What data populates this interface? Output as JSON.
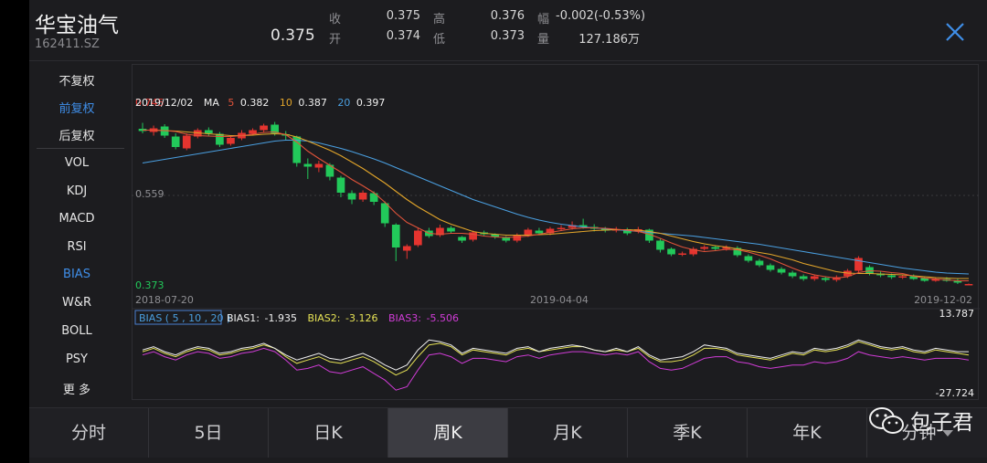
{
  "stock": {
    "name": "华宝油气",
    "code": "162411.SZ",
    "price": "0.375"
  },
  "quote": [
    {
      "label": "收",
      "value": "0.375"
    },
    {
      "label": "高",
      "value": "0.376"
    },
    {
      "label": "幅",
      "value": "-0.002(-0.53%)"
    },
    {
      "label": "开",
      "value": "0.374"
    },
    {
      "label": "低",
      "value": "0.373"
    },
    {
      "label": "量",
      "value": "127.186万"
    }
  ],
  "sidebar": {
    "adjust": [
      {
        "label": "不复权",
        "active": false
      },
      {
        "label": "前复权",
        "active": true
      },
      {
        "label": "后复权",
        "active": false
      }
    ],
    "indicators": [
      {
        "label": "VOL",
        "active": false
      },
      {
        "label": "KDJ",
        "active": false
      },
      {
        "label": "MACD",
        "active": false
      },
      {
        "label": "RSI",
        "active": false
      },
      {
        "label": "BIAS",
        "active": true
      },
      {
        "label": "W&R",
        "active": false
      },
      {
        "label": "BOLL",
        "active": false
      },
      {
        "label": "PSY",
        "active": false
      },
      {
        "label": "更 多",
        "active": false
      }
    ]
  },
  "chart_data": {
    "type": "candlestick",
    "ma_legend": {
      "date": "2019/12/02",
      "label": "MA",
      "items": [
        {
          "period": "5",
          "value": "0.382",
          "color": "#e0533a"
        },
        {
          "period": "10",
          "value": "0.387",
          "color": "#e2a52a"
        },
        {
          "period": "20",
          "value": "0.397",
          "color": "#4a9fe0"
        }
      ]
    },
    "y_labels": {
      "top": "0.745",
      "mid": "0.559",
      "bottom": "0.373"
    },
    "ylim": [
      0.373,
      0.745
    ],
    "x_labels": [
      "2018-07-20",
      "2019-04-04",
      "2019-12-02"
    ],
    "colors": {
      "up": "#e5342f",
      "down": "#22c95a",
      "ma5": "#e0533a",
      "ma10": "#e2a52a",
      "ma20": "#4a9fe0"
    },
    "candles": [
      [
        0.715,
        0.71,
        0.728,
        0.705
      ],
      [
        0.708,
        0.716,
        0.722,
        0.7
      ],
      [
        0.72,
        0.7,
        0.725,
        0.695
      ],
      [
        0.698,
        0.675,
        0.705,
        0.67
      ],
      [
        0.672,
        0.7,
        0.705,
        0.668
      ],
      [
        0.698,
        0.712,
        0.716,
        0.694
      ],
      [
        0.712,
        0.705,
        0.718,
        0.7
      ],
      [
        0.704,
        0.68,
        0.708,
        0.675
      ],
      [
        0.682,
        0.695,
        0.7,
        0.678
      ],
      [
        0.694,
        0.706,
        0.712,
        0.69
      ],
      [
        0.704,
        0.712,
        0.716,
        0.7
      ],
      [
        0.712,
        0.722,
        0.726,
        0.708
      ],
      [
        0.724,
        0.705,
        0.73,
        0.7
      ],
      [
        0.703,
        0.7,
        0.71,
        0.69
      ],
      [
        0.698,
        0.64,
        0.7,
        0.632
      ],
      [
        0.638,
        0.632,
        0.65,
        0.605
      ],
      [
        0.63,
        0.638,
        0.645,
        0.62
      ],
      [
        0.636,
        0.61,
        0.64,
        0.602
      ],
      [
        0.608,
        0.575,
        0.612,
        0.565
      ],
      [
        0.574,
        0.56,
        0.58,
        0.55
      ],
      [
        0.56,
        0.575,
        0.58,
        0.555
      ],
      [
        0.574,
        0.555,
        0.578,
        0.548
      ],
      [
        0.552,
        0.508,
        0.556,
        0.5
      ],
      [
        0.505,
        0.455,
        0.508,
        0.425
      ],
      [
        0.448,
        0.458,
        0.462,
        0.43
      ],
      [
        0.46,
        0.492,
        0.498,
        0.456
      ],
      [
        0.492,
        0.48,
        0.498,
        0.476
      ],
      [
        0.482,
        0.498,
        0.505,
        0.478
      ],
      [
        0.498,
        0.49,
        0.502,
        0.486
      ],
      [
        0.478,
        0.47,
        0.48,
        0.465
      ],
      [
        0.472,
        0.488,
        0.492,
        0.468
      ],
      [
        0.488,
        0.484,
        0.492,
        0.48
      ],
      [
        0.484,
        0.478,
        0.486,
        0.474
      ],
      [
        0.478,
        0.47,
        0.48,
        0.466
      ],
      [
        0.47,
        0.482,
        0.486,
        0.466
      ],
      [
        0.482,
        0.494,
        0.498,
        0.478
      ],
      [
        0.492,
        0.486,
        0.498,
        0.482
      ],
      [
        0.486,
        0.496,
        0.5,
        0.482
      ],
      [
        0.496,
        0.498,
        0.504,
        0.492
      ],
      [
        0.498,
        0.504,
        0.512,
        0.494
      ],
      [
        0.504,
        0.5,
        0.518,
        0.496
      ],
      [
        0.5,
        0.496,
        0.506,
        0.49
      ],
      [
        0.496,
        0.492,
        0.5,
        0.488
      ],
      [
        0.492,
        0.495,
        0.5,
        0.488
      ],
      [
        0.495,
        0.486,
        0.498,
        0.482
      ],
      [
        0.49,
        0.495,
        0.5,
        0.486
      ],
      [
        0.494,
        0.47,
        0.496,
        0.465
      ],
      [
        0.47,
        0.45,
        0.474,
        0.444
      ],
      [
        0.452,
        0.44,
        0.455,
        0.436
      ],
      [
        0.44,
        0.442,
        0.446,
        0.436
      ],
      [
        0.44,
        0.452,
        0.456,
        0.436
      ],
      [
        0.452,
        0.456,
        0.46,
        0.448
      ],
      [
        0.456,
        0.452,
        0.46,
        0.448
      ],
      [
        0.452,
        0.456,
        0.46,
        0.448
      ],
      [
        0.454,
        0.438,
        0.458,
        0.434
      ],
      [
        0.436,
        0.426,
        0.44,
        0.422
      ],
      [
        0.426,
        0.416,
        0.43,
        0.412
      ],
      [
        0.416,
        0.406,
        0.42,
        0.402
      ],
      [
        0.408,
        0.4,
        0.412,
        0.396
      ],
      [
        0.4,
        0.392,
        0.404,
        0.388
      ],
      [
        0.392,
        0.386,
        0.396,
        0.382
      ],
      [
        0.386,
        0.392,
        0.396,
        0.382
      ],
      [
        0.388,
        0.384,
        0.392,
        0.38
      ],
      [
        0.384,
        0.39,
        0.394,
        0.38
      ],
      [
        0.392,
        0.404,
        0.408,
        0.388
      ],
      [
        0.404,
        0.432,
        0.436,
        0.4
      ],
      [
        0.412,
        0.398,
        0.416,
        0.394
      ],
      [
        0.398,
        0.394,
        0.402,
        0.39
      ],
      [
        0.394,
        0.39,
        0.398,
        0.386
      ],
      [
        0.39,
        0.392,
        0.396,
        0.386
      ],
      [
        0.392,
        0.386,
        0.396,
        0.384
      ],
      [
        0.388,
        0.382,
        0.392,
        0.38
      ],
      [
        0.382,
        0.386,
        0.39,
        0.38
      ],
      [
        0.386,
        0.382,
        0.39,
        0.38
      ],
      [
        0.382,
        0.378,
        0.386,
        0.375
      ],
      [
        0.374,
        0.375,
        0.376,
        0.373
      ]
    ],
    "ma5": [
      0.712,
      0.712,
      0.711,
      0.709,
      0.703,
      0.7,
      0.699,
      0.698,
      0.698,
      0.7,
      0.703,
      0.707,
      0.708,
      0.702,
      0.686,
      0.666,
      0.65,
      0.635,
      0.62,
      0.604,
      0.59,
      0.575,
      0.554,
      0.53,
      0.51,
      0.498,
      0.486,
      0.484,
      0.486,
      0.486,
      0.484,
      0.48,
      0.478,
      0.477,
      0.478,
      0.48,
      0.484,
      0.488,
      0.492,
      0.496,
      0.498,
      0.498,
      0.497,
      0.495,
      0.493,
      0.49,
      0.484,
      0.475,
      0.465,
      0.456,
      0.45,
      0.446,
      0.448,
      0.451,
      0.45,
      0.445,
      0.438,
      0.43,
      0.42,
      0.41,
      0.401,
      0.395,
      0.391,
      0.388,
      0.391,
      0.4,
      0.404,
      0.403,
      0.4,
      0.398,
      0.392,
      0.388,
      0.386,
      0.384,
      0.382,
      0.382
    ],
    "ma10": [
      0.712,
      0.712,
      0.711,
      0.71,
      0.708,
      0.706,
      0.704,
      0.702,
      0.7,
      0.7,
      0.701,
      0.703,
      0.704,
      0.703,
      0.697,
      0.688,
      0.678,
      0.668,
      0.656,
      0.642,
      0.628,
      0.612,
      0.596,
      0.578,
      0.56,
      0.544,
      0.53,
      0.516,
      0.506,
      0.498,
      0.49,
      0.486,
      0.484,
      0.482,
      0.482,
      0.482,
      0.483,
      0.484,
      0.486,
      0.488,
      0.49,
      0.492,
      0.493,
      0.494,
      0.494,
      0.493,
      0.49,
      0.486,
      0.48,
      0.474,
      0.468,
      0.463,
      0.459,
      0.456,
      0.452,
      0.448,
      0.444,
      0.44,
      0.434,
      0.428,
      0.42,
      0.414,
      0.408,
      0.402,
      0.399,
      0.398,
      0.398,
      0.397,
      0.396,
      0.395,
      0.393,
      0.391,
      0.389,
      0.388,
      0.387,
      0.387
    ],
    "ma20": [
      0.64,
      0.644,
      0.648,
      0.652,
      0.656,
      0.66,
      0.664,
      0.668,
      0.672,
      0.676,
      0.68,
      0.684,
      0.688,
      0.69,
      0.69,
      0.688,
      0.684,
      0.678,
      0.672,
      0.665,
      0.657,
      0.649,
      0.64,
      0.63,
      0.62,
      0.61,
      0.6,
      0.59,
      0.58,
      0.57,
      0.56,
      0.552,
      0.544,
      0.536,
      0.528,
      0.521,
      0.515,
      0.51,
      0.506,
      0.503,
      0.5,
      0.498,
      0.496,
      0.494,
      0.492,
      0.49,
      0.488,
      0.486,
      0.484,
      0.482,
      0.48,
      0.477,
      0.474,
      0.471,
      0.468,
      0.465,
      0.462,
      0.458,
      0.454,
      0.45,
      0.446,
      0.442,
      0.438,
      0.434,
      0.43,
      0.426,
      0.422,
      0.418,
      0.414,
      0.41,
      0.407,
      0.404,
      0.401,
      0.399,
      0.398,
      0.397
    ],
    "bias": {
      "legend": "BIAS ( 5 , 10 , 20 )",
      "items": [
        {
          "label": "BIAS1:",
          "value": "-1.935",
          "color": "#f0f0f0"
        },
        {
          "label": "BIAS2:",
          "value": "-3.126",
          "color": "#e6e255"
        },
        {
          "label": "BIAS3:",
          "value": "-5.506",
          "color": "#d03cd6"
        }
      ],
      "max_label": "13.787",
      "min_label": "-27.724",
      "ylim": [
        -27.724,
        13.787
      ],
      "colors": {
        "b1": "#f0f0f0",
        "b2": "#e6e255",
        "b3": "#d03cd6"
      },
      "b1": [
        0,
        2,
        -1,
        -3,
        0,
        2,
        1,
        -2,
        -1,
        1,
        2,
        4,
        1,
        -3,
        -6,
        -4,
        -2,
        -5,
        -6,
        -4,
        -2,
        -5,
        -9,
        -12,
        -9,
        0,
        6,
        5,
        3,
        -2,
        1,
        0,
        -1,
        -2,
        1,
        2,
        -1,
        1,
        2,
        3,
        2,
        0,
        -1,
        1,
        -1,
        2,
        -3,
        -6,
        -5,
        -4,
        -1,
        3,
        2,
        1,
        -2,
        -3,
        -4,
        -5,
        -3,
        -1,
        -2,
        1,
        0,
        1,
        3,
        6,
        4,
        2,
        1,
        2,
        0,
        -1,
        1,
        0,
        -1,
        -1
      ],
      "b2": [
        -1,
        1,
        -2,
        -4,
        -1,
        1,
        0,
        -3,
        -2,
        0,
        1,
        3,
        1,
        -4,
        -8,
        -6,
        -4,
        -7,
        -8,
        -6,
        -4,
        -7,
        -11,
        -15,
        -12,
        -4,
        3,
        4,
        2,
        -3,
        0,
        -1,
        -2,
        -3,
        0,
        1,
        -1,
        0,
        1,
        2,
        2,
        0,
        -1,
        0,
        -1,
        1,
        -4,
        -7,
        -7,
        -6,
        -3,
        1,
        1,
        0,
        -3,
        -4,
        -5,
        -6,
        -4,
        -2,
        -3,
        0,
        -1,
        0,
        2,
        5,
        3,
        1,
        0,
        1,
        -1,
        -2,
        0,
        -1,
        -2,
        -3
      ],
      "b3": [
        -3,
        -1,
        -4,
        -6,
        -3,
        -1,
        -2,
        -5,
        -4,
        -2,
        -1,
        1,
        -1,
        -6,
        -12,
        -11,
        -9,
        -13,
        -14,
        -12,
        -10,
        -14,
        -18,
        -24,
        -22,
        -12,
        -3,
        -2,
        -4,
        -8,
        -5,
        -5,
        -6,
        -7,
        -4,
        -3,
        -5,
        -3,
        -2,
        -1,
        -1,
        -2,
        -3,
        -2,
        -3,
        -1,
        -7,
        -11,
        -12,
        -11,
        -8,
        -5,
        -4,
        -4,
        -7,
        -8,
        -10,
        -11,
        -10,
        -9,
        -9,
        -7,
        -8,
        -7,
        -5,
        -1,
        -3,
        -4,
        -5,
        -4,
        -5,
        -6,
        -5,
        -5,
        -5,
        -6
      ]
    }
  },
  "tabs": [
    {
      "label": "分时",
      "active": false
    },
    {
      "label": "5日",
      "active": false
    },
    {
      "label": "日K",
      "active": false
    },
    {
      "label": "周K",
      "active": true
    },
    {
      "label": "月K",
      "active": false
    },
    {
      "label": "季K",
      "active": false
    },
    {
      "label": "年K",
      "active": false
    },
    {
      "label": "分钟",
      "active": false
    }
  ],
  "watermark": {
    "text": "包子君"
  }
}
